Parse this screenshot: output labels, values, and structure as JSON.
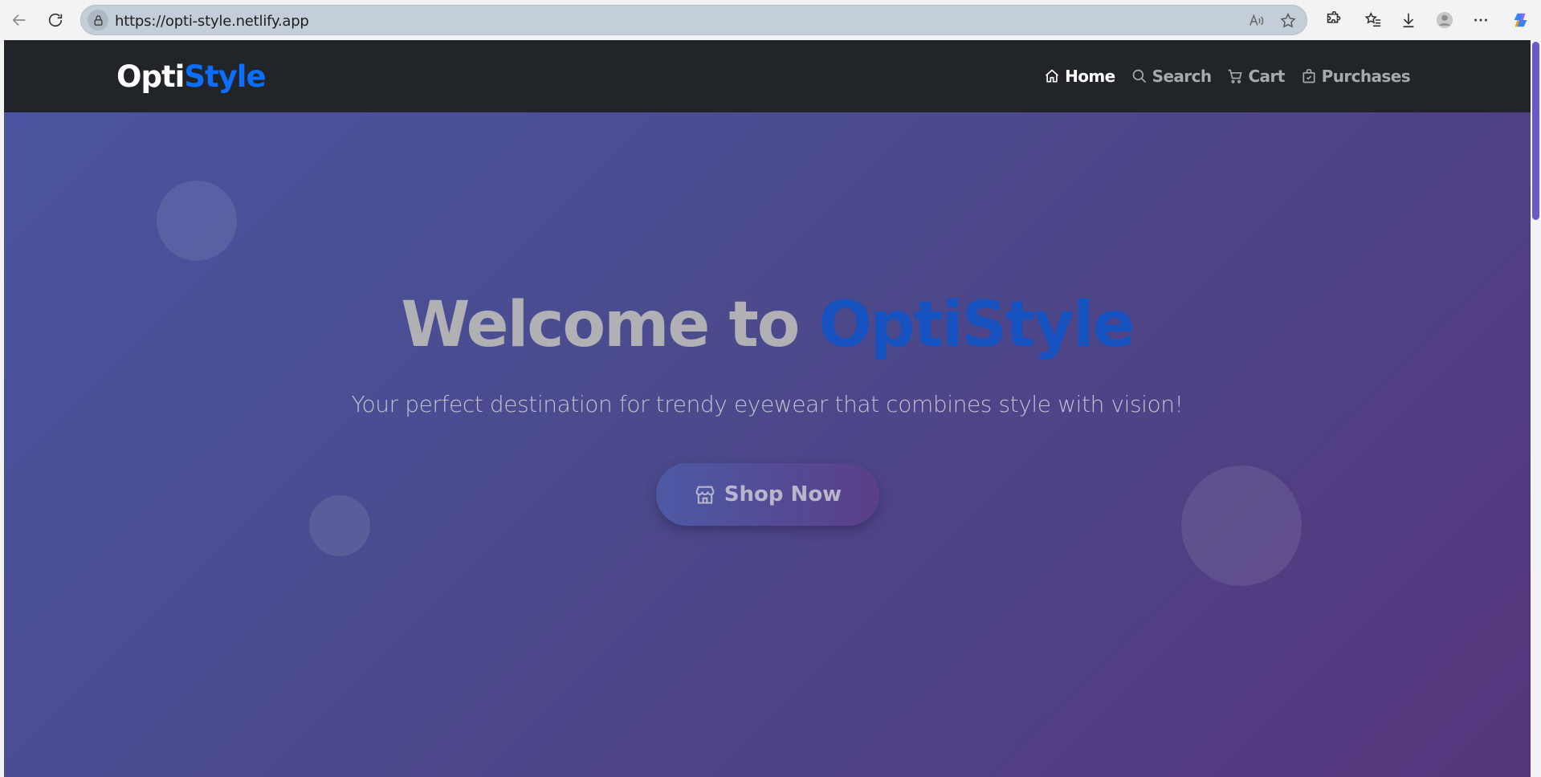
{
  "browser": {
    "url": "https://opti-style.netlify.app"
  },
  "navbar": {
    "brand_part1": "Opti",
    "brand_part2": "Style",
    "links": [
      {
        "label": "Home",
        "icon": "home-icon",
        "active": true
      },
      {
        "label": "Search",
        "icon": "search-icon",
        "active": false
      },
      {
        "label": "Cart",
        "icon": "cart-icon",
        "active": false
      },
      {
        "label": "Purchases",
        "icon": "bag-check-icon",
        "active": false
      }
    ]
  },
  "hero": {
    "title_part1": "Welcome to ",
    "title_part2": "OptiStyle",
    "subtitle": "Your perfect destination for trendy eyewear that combines style with vision!",
    "cta_label": "Shop Now",
    "cta_icon": "shop-icon"
  },
  "colors": {
    "navbar_bg": "#212529",
    "brand_accent": "#0d6efd",
    "hero_gradient_start": "#4a54a0",
    "hero_gradient_end": "#55357c"
  }
}
